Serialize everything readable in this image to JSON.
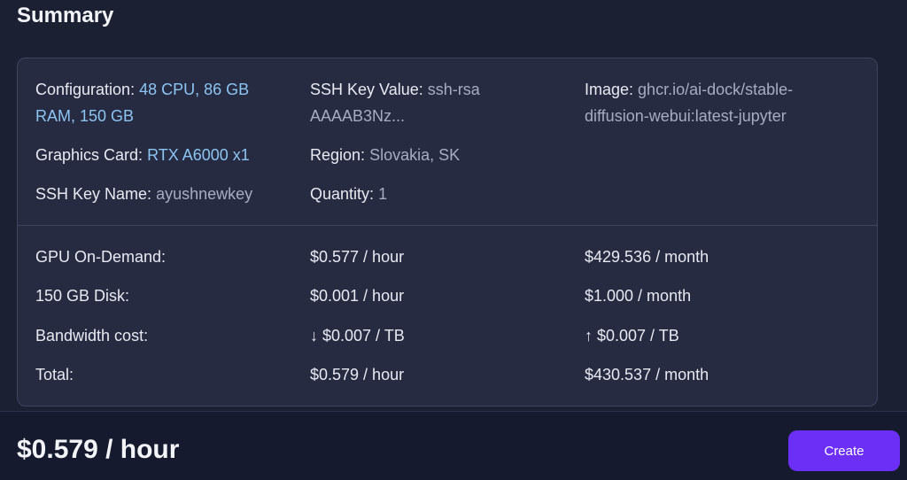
{
  "title": "Summary",
  "config": {
    "configuration_label": "Configuration:",
    "configuration_value_line1": "48 CPU, 86 GB",
    "configuration_value_line2": "RAM, 150 GB",
    "graphics_label": "Graphics Card:",
    "graphics_value": "RTX A6000 x1",
    "ssh_name_label": "SSH Key Name:",
    "ssh_name_value": "ayushnewkey",
    "ssh_value_label": "SSH Key Value:",
    "ssh_value_line1": "ssh-rsa",
    "ssh_value_line2": "AAAAB3Nz...",
    "region_label": "Region:",
    "region_value": "Slovakia, SK",
    "quantity_label": "Quantity:",
    "quantity_value": "1",
    "image_label": "Image:",
    "image_value_line1": "ghcr.io/ai-dock/stable-",
    "image_value_line2": "diffusion-webui:latest-jupyter"
  },
  "costs": [
    {
      "label": "GPU On-Demand:",
      "hourly": "$0.577 / hour",
      "monthly": "$429.536 / month"
    },
    {
      "label": "150 GB Disk:",
      "hourly": "$0.001 / hour",
      "monthly": "$1.000 / month"
    },
    {
      "label": "Bandwidth cost:",
      "hourly": "↓ $0.007 / TB",
      "monthly": "↑ $0.007 / TB"
    },
    {
      "label": "Total:",
      "hourly": "$0.579 / hour",
      "monthly": "$430.537 / month"
    }
  ],
  "footer": {
    "price": "$0.579 / hour",
    "create_label": "Create"
  },
  "colors": {
    "background": "#1c2033",
    "card": "#272b42",
    "accent_text": "#8cc4f2",
    "button": "#6b2ff5"
  }
}
